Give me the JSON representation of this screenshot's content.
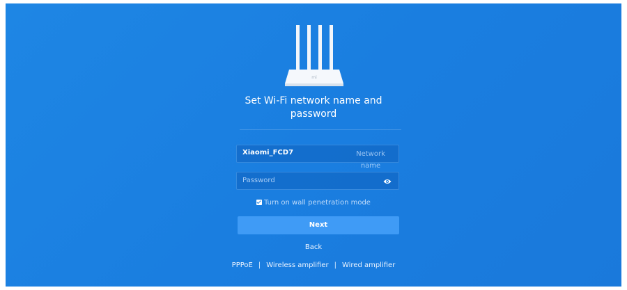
{
  "page": {
    "title_line1": "Set Wi-Fi network name and",
    "title_line2": "password",
    "router_logo_text": "mi"
  },
  "form": {
    "network_name_value": "Xiaomi_FCD7",
    "network_name_hint_line1": "Network",
    "network_name_hint_line2": "name",
    "password_placeholder": "Password",
    "wall_penetration_label": "Turn on wall penetration mode",
    "wall_penetration_checked": true,
    "next_label": "Next",
    "back_label": "Back"
  },
  "links": {
    "pppoe": "PPPoE",
    "wireless_amplifier": "Wireless amplifier",
    "wired_amplifier": "Wired amplifier",
    "separator": "|"
  },
  "colors": {
    "background": "#1e86e4",
    "button": "#3f9bf6",
    "text": "#ffffff"
  },
  "icons": {
    "router": "router-icon",
    "eye": "eye-icon",
    "checkbox": "checkbox-checked-icon"
  }
}
